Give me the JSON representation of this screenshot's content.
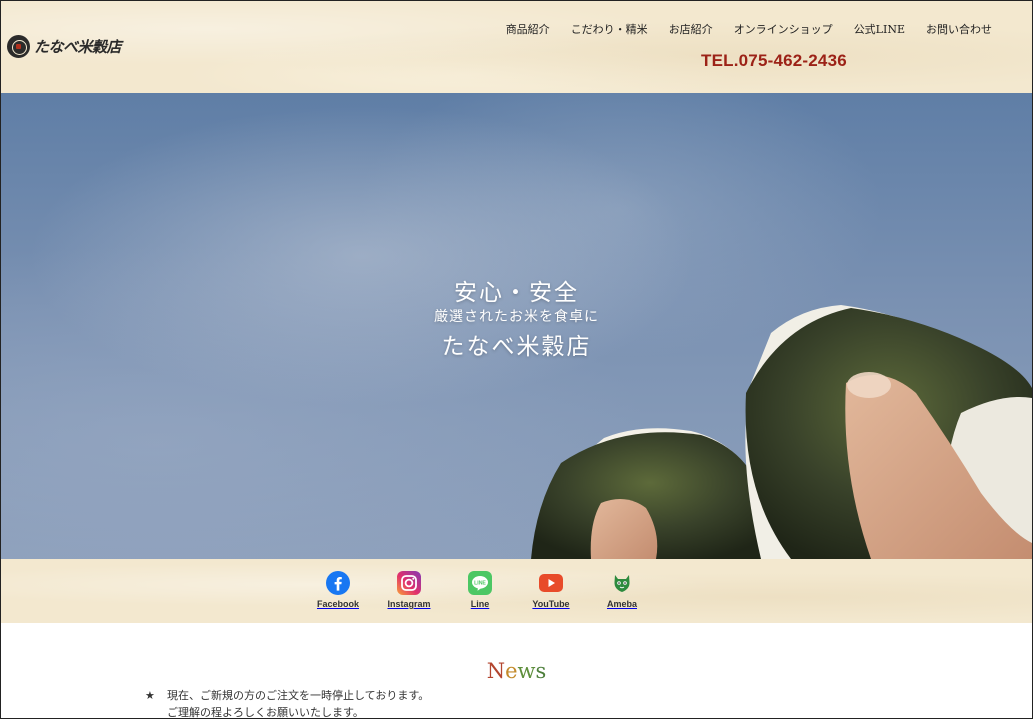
{
  "header": {
    "logo_text": "たなべ米穀店",
    "nav": [
      {
        "label": "商品紹介",
        "name": "nav-products"
      },
      {
        "label": "こだわり・精米",
        "name": "nav-kodawari"
      },
      {
        "label": "お店紹介",
        "name": "nav-about"
      },
      {
        "label": "オンラインショップ",
        "name": "nav-online-shop"
      },
      {
        "label": "公式LINE",
        "name": "nav-line"
      },
      {
        "label": "お問い合わせ",
        "name": "nav-contact"
      }
    ],
    "tel": "TEL.075-462-2436"
  },
  "hero": {
    "line1": "安心・安全",
    "line2": "厳選されたお米を食卓に",
    "line3": "たなべ米穀店"
  },
  "social": [
    {
      "label": "Facebook",
      "icon": "facebook-icon",
      "color": "#1877f2"
    },
    {
      "label": "Instagram",
      "icon": "instagram-icon",
      "color": "#c13584"
    },
    {
      "label": "Line",
      "icon": "line-icon",
      "color": "#4cc764"
    },
    {
      "label": "YouTube",
      "icon": "youtube-icon",
      "color": "#e84b2a"
    },
    {
      "label": "Ameba",
      "icon": "ameba-icon",
      "color": "#2d8a3e"
    }
  ],
  "news": {
    "title_chars": [
      "N",
      "e",
      "w",
      "s"
    ],
    "items": [
      {
        "bullet": "★",
        "line1": "現在、ご新規の方のご注文を一時停止しております。",
        "line2": "ご理解の程よろしくお願いいたします。"
      }
    ]
  },
  "colors": {
    "header_bg": "#f3e8cf",
    "tel": "#9c2217",
    "sky": "#7a91b2"
  }
}
